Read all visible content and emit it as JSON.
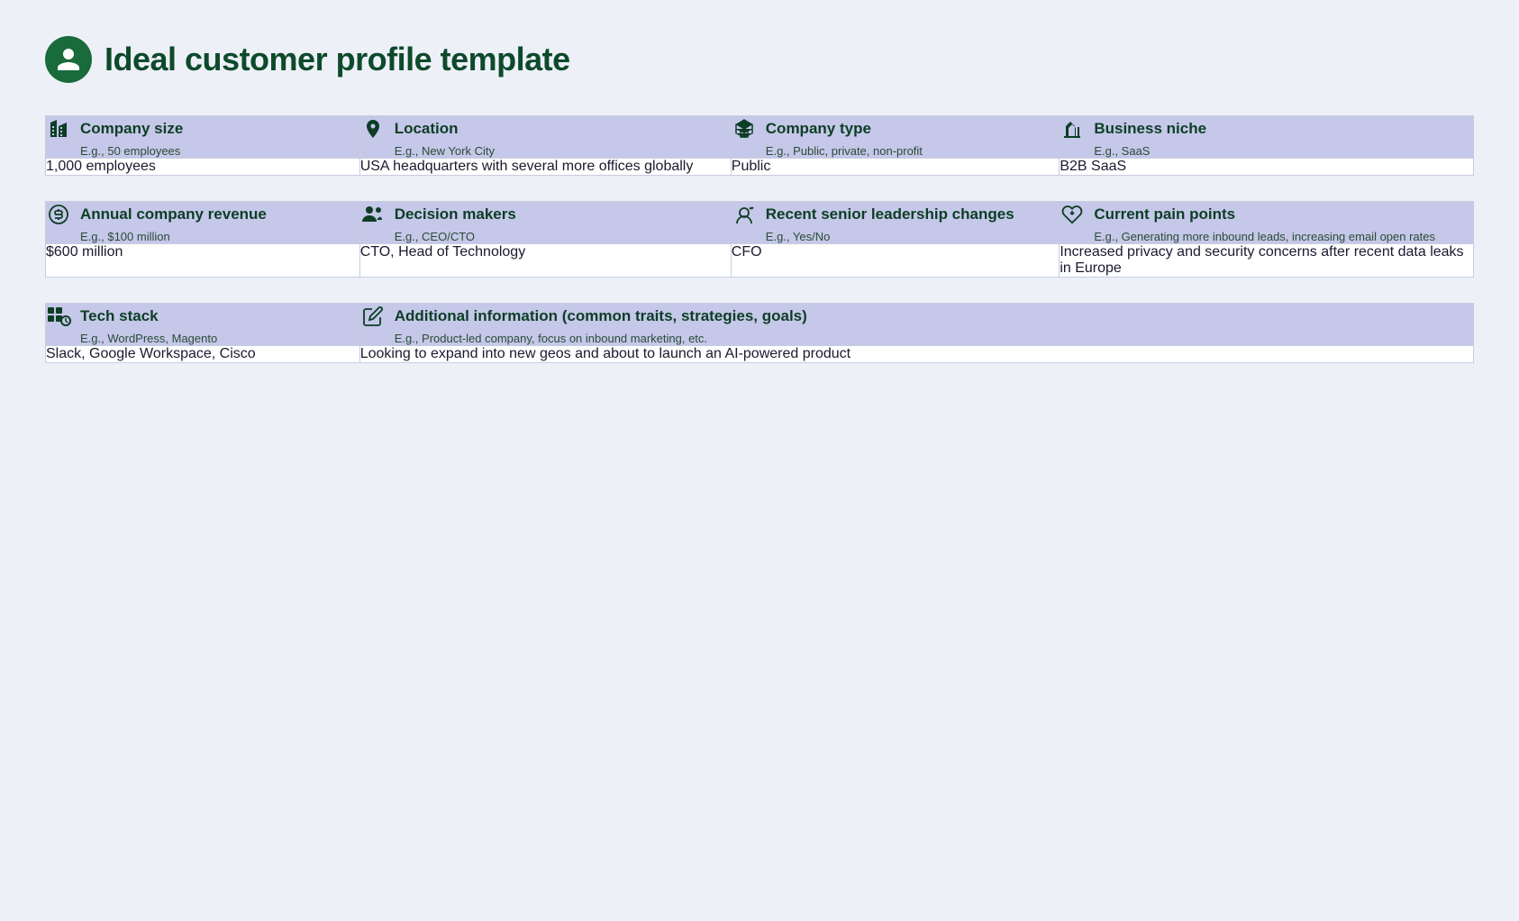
{
  "page": {
    "title": "Ideal customer profile template"
  },
  "section1": {
    "headers": [
      {
        "id": "company-size",
        "label": "Company size",
        "subtitle": "E.g., 50 employees"
      },
      {
        "id": "location",
        "label": "Location",
        "subtitle": "E.g., New York City"
      },
      {
        "id": "company-type",
        "label": "Company type",
        "subtitle": "E.g., Public, private, non-profit"
      },
      {
        "id": "business-niche",
        "label": "Business niche",
        "subtitle": "E.g., SaaS"
      }
    ],
    "data": [
      "1,000 employees",
      "USA headquarters with several more offices globally",
      "Public",
      "B2B SaaS"
    ]
  },
  "section2": {
    "headers": [
      {
        "id": "annual-revenue",
        "label": "Annual company revenue",
        "subtitle": "E.g., $100 million"
      },
      {
        "id": "decision-makers",
        "label": "Decision makers",
        "subtitle": "E.g., CEO/CTO"
      },
      {
        "id": "senior-leadership",
        "label": "Recent senior leadership changes",
        "subtitle": "E.g., Yes/No"
      },
      {
        "id": "pain-points",
        "label": "Current pain points",
        "subtitle": "E.g., Generating more inbound leads, increasing email open rates"
      }
    ],
    "data": [
      "$600 million",
      "CTO, Head of Technology",
      "CFO",
      "Increased privacy and security concerns after recent data leaks in Europe"
    ]
  },
  "section3": {
    "headers": [
      {
        "id": "tech-stack",
        "label": "Tech stack",
        "subtitle": "E.g., WordPress, Magento"
      },
      {
        "id": "additional-info",
        "label": "Additional information (common traits, strategies, goals)",
        "subtitle": "E.g., Product-led company, focus on inbound marketing, etc."
      }
    ],
    "data": [
      "Slack, Google Workspace, Cisco",
      "Looking to expand into new geos and about to launch an AI-powered product"
    ]
  }
}
